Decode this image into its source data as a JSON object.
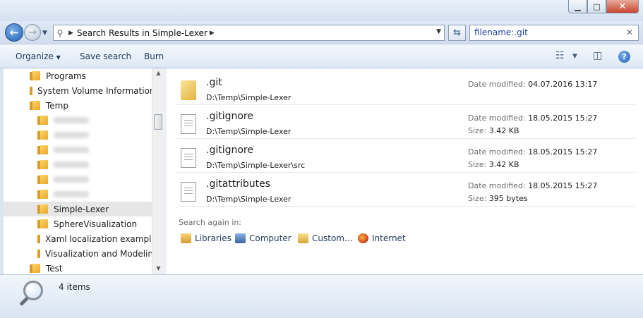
{
  "navigation": {
    "address_segment": "Search Results in Simple-Lexer",
    "search_query": "filename:.git"
  },
  "toolbar": {
    "organize": "Organize",
    "save_search": "Save search",
    "burn": "Burn"
  },
  "tree": [
    {
      "label": "Programs",
      "indent": 0
    },
    {
      "label": "System Volume Information",
      "indent": 0
    },
    {
      "label": "Temp",
      "indent": 0
    },
    {
      "label": "",
      "indent": 1,
      "blurred": true
    },
    {
      "label": "",
      "indent": 1,
      "blurred": true
    },
    {
      "label": "",
      "indent": 1,
      "blurred": true
    },
    {
      "label": "",
      "indent": 1,
      "blurred": true
    },
    {
      "label": "",
      "indent": 1,
      "blurred": true
    },
    {
      "label": "",
      "indent": 1,
      "blurred": true
    },
    {
      "label": "Simple-Lexer",
      "indent": 1,
      "selected": true
    },
    {
      "label": "SphereVisualization",
      "indent": 1
    },
    {
      "label": "Xaml localization example",
      "indent": 1
    },
    {
      "label": "Visualization and Modeling",
      "indent": 1
    },
    {
      "label": "Test",
      "indent": 0
    }
  ],
  "results": [
    {
      "name": ".git",
      "path": "D:\\Temp\\Simple-Lexer",
      "type": "folder",
      "date_label": "Date modified:",
      "date": "04.07.2016 13:17",
      "size_label": "",
      "size": ""
    },
    {
      "name": ".gitignore",
      "path": "D:\\Temp\\Simple-Lexer",
      "type": "file",
      "date_label": "Date modified:",
      "date": "18.05.2015 15:27",
      "size_label": "Size:",
      "size": "3.42 KB"
    },
    {
      "name": ".gitignore",
      "path": "D:\\Temp\\Simple-Lexer\\src",
      "type": "file",
      "date_label": "Date modified:",
      "date": "18.05.2015 15:27",
      "size_label": "Size:",
      "size": "3.42 KB"
    },
    {
      "name": ".gitattributes",
      "path": "D:\\Temp\\Simple-Lexer",
      "type": "file",
      "date_label": "Date modified:",
      "date": "18.05.2015 15:27",
      "size_label": "Size:",
      "size": "395 bytes"
    }
  ],
  "search_again": {
    "label": "Search again in:",
    "libraries": "Libraries",
    "computer": "Computer",
    "custom": "Custom...",
    "internet": "Internet"
  },
  "details": {
    "item_count": "4 items"
  },
  "icons": {
    "back": "back-arrow-icon",
    "forward": "forward-arrow-icon",
    "refresh": "refresh-icon",
    "clear": "clear-x-icon",
    "help": "help-icon"
  }
}
